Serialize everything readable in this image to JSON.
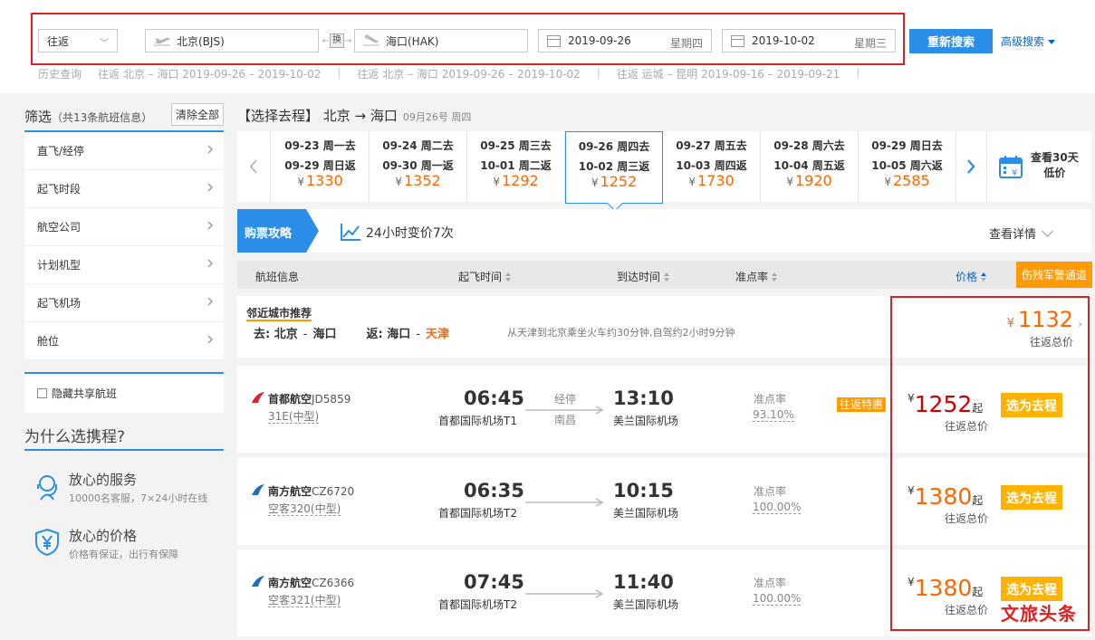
{
  "search": {
    "trip_type": "往返",
    "from_city": "北京(BJS)",
    "swap_label": "换",
    "to_city": "海口(HAK)",
    "depart_date": "2019-09-26",
    "depart_weekday": "星期四",
    "return_date": "2019-10-02",
    "return_weekday": "星期三",
    "search_button": "重新搜索",
    "advanced_search": "高级搜索"
  },
  "history": {
    "label": "历史查询",
    "items": [
      "往返 北京 – 海口 2019-09-26 – 2019-10-02",
      "往返 北京 – 海口 2019-09-26 – 2019-10-02",
      "往返 运城 – 昆明 2019-09-16 – 2019-09-21"
    ]
  },
  "filter": {
    "title": "筛选",
    "count": "（共13条航班信息）",
    "clear_all": "清除全部",
    "items": [
      "直飞/经停",
      "起飞时段",
      "航空公司",
      "计划机型",
      "起飞机场",
      "舱位"
    ],
    "hide_shared": "隐藏共享航班"
  },
  "why": {
    "title": "为什么选携程?",
    "items": [
      {
        "title": "放心的服务",
        "sub": "10000名客服，7×24小时在线",
        "icon": "headset-icon"
      },
      {
        "title": "放心的价格",
        "sub": "价格有保证，出行有保障",
        "icon": "yen-shield-icon"
      }
    ]
  },
  "route_header": {
    "title": "【选择去程】 北京 → 海口",
    "date": "09月26号 周四"
  },
  "date_strip": {
    "currency": "¥",
    "days": [
      {
        "go": "09-23 周一去",
        "ret": "09-29 周日返",
        "price": "1330",
        "active": false
      },
      {
        "go": "09-24 周二去",
        "ret": "09-30 周一返",
        "price": "1352",
        "active": false
      },
      {
        "go": "09-25 周三去",
        "ret": "10-01 周二返",
        "price": "1292",
        "active": false
      },
      {
        "go": "09-26 周四去",
        "ret": "10-02 周三返",
        "price": "1252",
        "active": true
      },
      {
        "go": "09-27 周五去",
        "ret": "10-03 周四返",
        "price": "1730",
        "active": false
      },
      {
        "go": "09-28 周六去",
        "ret": "10-04 周五返",
        "price": "1920",
        "active": false
      },
      {
        "go": "09-29 周日去",
        "ret": "10-05 周六返",
        "price": "2585",
        "active": false
      }
    ],
    "calendar_30_line1": "查看30天",
    "calendar_30_line2": "低价"
  },
  "strategy": {
    "tag": "购票攻略",
    "trend": "24小时变价7次",
    "details": "查看详情"
  },
  "columns": {
    "flight": "航班信息",
    "depart": "起飞时间",
    "arrive": "到达时间",
    "ontime": "准点率",
    "price": "价格",
    "military": "伤残军警通道"
  },
  "nearby": {
    "title": "邻近城市推荐",
    "go_label": "去:",
    "go_from": "北京",
    "go_to": "海口",
    "ret_label": "返:",
    "ret_from": "海口",
    "ret_to": "天津",
    "dash": "-",
    "note": "从天津到北京乘坐火车约30分钟,自驾约2小时9分钟",
    "currency": "¥",
    "price": "1132",
    "price_sub": "往返总价"
  },
  "flights": [
    {
      "airline": "首都航空",
      "flight_no": "JD5859",
      "plane": "31E(中型)",
      "dep_time": "06:45",
      "dep_airport": "首都国际机场T1",
      "stop_tag": "经停",
      "stop_city": "南昌",
      "arr_time": "13:10",
      "arr_airport": "美兰国际机场",
      "ontime_label": "准点率",
      "ontime": "93.10%",
      "promo": "往返特惠",
      "currency": "¥",
      "price": "1252",
      "price_from": "起",
      "price_sub": "往返总价",
      "button": "选为去程",
      "logo_color": "#d8262e"
    },
    {
      "airline": "南方航空",
      "flight_no": "CZ6720",
      "plane": "空客320(中型)",
      "dep_time": "06:35",
      "dep_airport": "首都国际机场T2",
      "arr_time": "10:15",
      "arr_airport": "美兰国际机场",
      "ontime_label": "准点率",
      "ontime": "100.00%",
      "currency": "¥",
      "price": "1380",
      "price_from": "起",
      "price_sub": "往返总价",
      "button": "选为去程",
      "logo_color": "#1d6fb8"
    },
    {
      "airline": "南方航空",
      "flight_no": "CZ6366",
      "plane": "空客321(中型)",
      "dep_time": "07:45",
      "dep_airport": "首都国际机场T2",
      "arr_time": "11:40",
      "arr_airport": "美兰国际机场",
      "ontime_label": "准点率",
      "ontime": "100.00%",
      "currency": "¥",
      "price": "1380",
      "price_from": "起",
      "price_sub": "往返总价",
      "button": "选为去程",
      "logo_color": "#1d6fb8"
    }
  ],
  "watermark": "文旅头条",
  "colors": {
    "accent": "#2b8fe9",
    "price": "#ff6600",
    "button": "#ffb300",
    "highlight_box": "#e02020"
  }
}
